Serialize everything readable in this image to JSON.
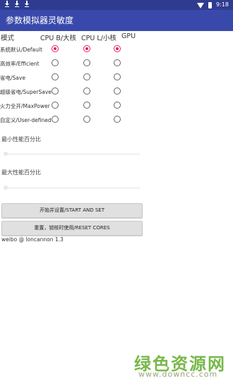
{
  "status_bar": {
    "time": "9:18"
  },
  "app_bar": {
    "title": "参数模拟器灵敏度"
  },
  "table": {
    "headers": [
      "模式",
      "CPU B/大核",
      "CPU L/小核",
      "GPU"
    ],
    "rows": [
      {
        "label": "系统默认/Default",
        "checked": [
          true,
          true,
          true
        ]
      },
      {
        "label": "高效率/Efficient",
        "checked": [
          false,
          false,
          false
        ]
      },
      {
        "label": "省电/Save",
        "checked": [
          false,
          false,
          false
        ]
      },
      {
        "label": "超级省电/SuperSave",
        "checked": [
          false,
          false,
          false
        ]
      },
      {
        "label": "火力全开/MaxPower",
        "checked": [
          false,
          false,
          false
        ]
      },
      {
        "label": "自定义/User-defined",
        "checked": [
          false,
          false,
          false
        ]
      }
    ]
  },
  "sliders": {
    "min_title": "最小性能百分比",
    "max_title": "最大性能百分比"
  },
  "buttons": {
    "start": "开始并设置/START AND SET",
    "reset": "重置，锁核时使用/RESET CORES"
  },
  "credit": "weibo @ loncannon 1.3",
  "watermark": {
    "cn": "绿色资源网",
    "url": "www.downcc.com"
  },
  "colors": {
    "status_bar": "#2e3b8f",
    "app_bar": "#3949ab",
    "radio_checked": "#e91e63"
  }
}
